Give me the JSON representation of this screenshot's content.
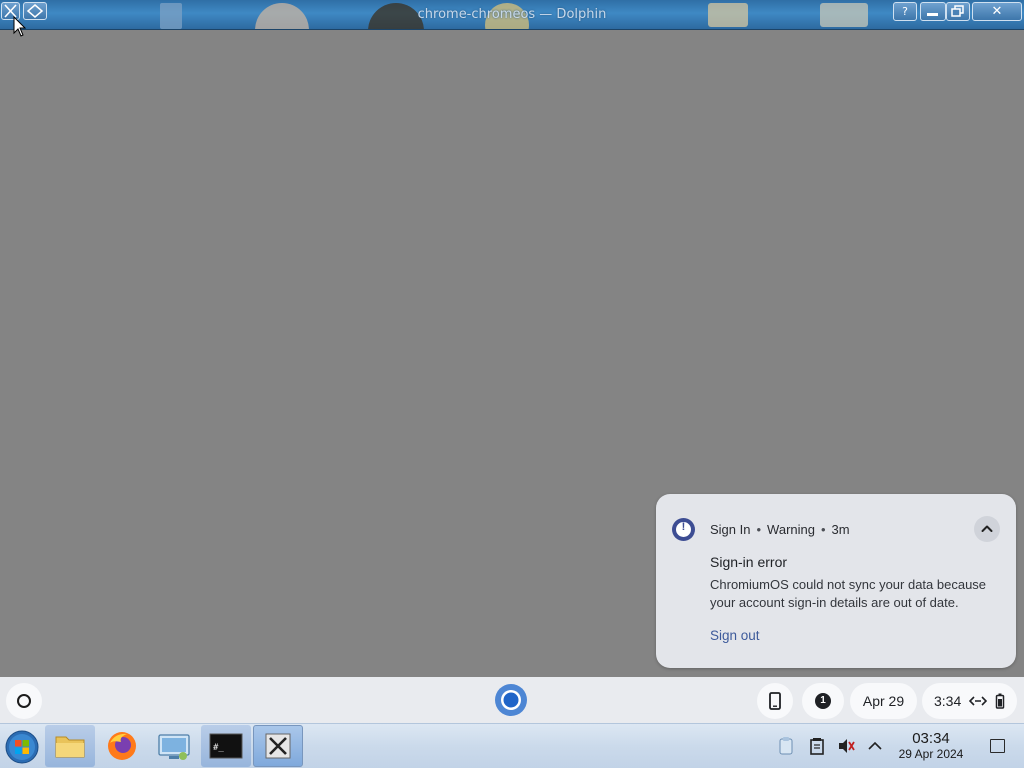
{
  "window": {
    "title": "chrome-chromeos — Dolphin"
  },
  "titlebar_buttons": {
    "help": "?",
    "minimize": "",
    "maximize": "",
    "close": "✕"
  },
  "notification": {
    "source": "Sign In",
    "severity": "Warning",
    "age": "3m",
    "separator": "•",
    "title": "Sign-in error",
    "body": "ChromiumOS could not sync your data because your account sign-in details are out of date.",
    "action": "Sign out"
  },
  "shelf": {
    "notification_count": "1",
    "date": "Apr 29",
    "time": "3:34"
  },
  "taskbar": {
    "time": "03:34",
    "date": "29 Apr 2024",
    "items": [
      "start-orb",
      "file-explorer",
      "firefox",
      "remote-desktop",
      "terminal",
      "x-window"
    ]
  },
  "colors": {
    "accent": "#3d4d93",
    "link": "#3d5a9b",
    "desktop": "#848484"
  }
}
